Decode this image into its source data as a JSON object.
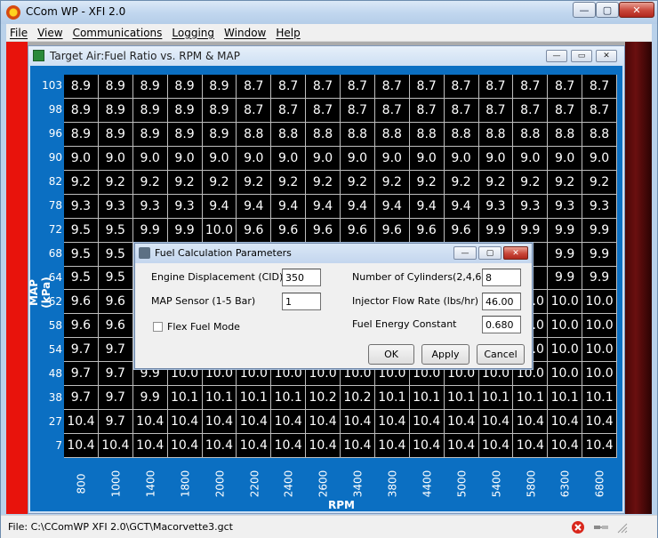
{
  "window": {
    "title": "CCom WP - XFI 2.0",
    "minimize": "—",
    "maximize": "▢",
    "close": "✕"
  },
  "menu": [
    "File",
    "View",
    "Communications",
    "Logging",
    "Window",
    "Help"
  ],
  "child": {
    "title": "Target Air:Fuel Ratio vs. RPM & MAP",
    "minimize": "—",
    "restore": "▭",
    "close": "✕"
  },
  "table": {
    "ylabel": "MAP (kPa)",
    "xlabel": "RPM",
    "rows": [
      "103",
      "98",
      "96",
      "90",
      "82",
      "78",
      "72",
      "68",
      "64",
      "62",
      "58",
      "54",
      "48",
      "38",
      "27",
      "7"
    ],
    "cols": [
      "800",
      "1000",
      "1400",
      "1800",
      "2000",
      "2200",
      "2400",
      "2600",
      "3400",
      "3800",
      "4400",
      "5000",
      "5400",
      "5800",
      "6300",
      "6800"
    ],
    "values": [
      [
        "8.9",
        "8.9",
        "8.9",
        "8.9",
        "8.9",
        "8.7",
        "8.7",
        "8.7",
        "8.7",
        "8.7",
        "8.7",
        "8.7",
        "8.7",
        "8.7",
        "8.7",
        "8.7"
      ],
      [
        "8.9",
        "8.9",
        "8.9",
        "8.9",
        "8.9",
        "8.7",
        "8.7",
        "8.7",
        "8.7",
        "8.7",
        "8.7",
        "8.7",
        "8.7",
        "8.7",
        "8.7",
        "8.7"
      ],
      [
        "8.9",
        "8.9",
        "8.9",
        "8.9",
        "8.9",
        "8.8",
        "8.8",
        "8.8",
        "8.8",
        "8.8",
        "8.8",
        "8.8",
        "8.8",
        "8.8",
        "8.8",
        "8.8"
      ],
      [
        "9.0",
        "9.0",
        "9.0",
        "9.0",
        "9.0",
        "9.0",
        "9.0",
        "9.0",
        "9.0",
        "9.0",
        "9.0",
        "9.0",
        "9.0",
        "9.0",
        "9.0",
        "9.0"
      ],
      [
        "9.2",
        "9.2",
        "9.2",
        "9.2",
        "9.2",
        "9.2",
        "9.2",
        "9.2",
        "9.2",
        "9.2",
        "9.2",
        "9.2",
        "9.2",
        "9.2",
        "9.2",
        "9.2"
      ],
      [
        "9.3",
        "9.3",
        "9.3",
        "9.3",
        "9.4",
        "9.4",
        "9.4",
        "9.4",
        "9.4",
        "9.4",
        "9.4",
        "9.4",
        "9.3",
        "9.3",
        "9.3",
        "9.3"
      ],
      [
        "9.5",
        "9.5",
        "9.9",
        "9.9",
        "10.0",
        "9.6",
        "9.6",
        "9.6",
        "9.6",
        "9.6",
        "9.6",
        "9.6",
        "9.9",
        "9.9",
        "9.9",
        "9.9"
      ],
      [
        "9.5",
        "9.5",
        "",
        "",
        "",
        "",
        "",
        "",
        "",
        "",
        "",
        "",
        "",
        "",
        "9.9",
        "9.9"
      ],
      [
        "9.5",
        "9.5",
        "",
        "",
        "",
        "",
        "",
        "",
        "",
        "",
        "",
        "",
        "",
        "",
        "9.9",
        "9.9"
      ],
      [
        "9.6",
        "9.6",
        "",
        "",
        "",
        "",
        "",
        "",
        "",
        "",
        "",
        "",
        "",
        "10.0",
        "10.0",
        "10.0"
      ],
      [
        "9.6",
        "9.6",
        "",
        "",
        "",
        "",
        "",
        "",
        "",
        "",
        "",
        "",
        "",
        "10.0",
        "10.0",
        "10.0"
      ],
      [
        "9.7",
        "9.7",
        "",
        "",
        "",
        "",
        "",
        "",
        "",
        "",
        "",
        "",
        "",
        "10.0",
        "10.0",
        "10.0"
      ],
      [
        "9.7",
        "9.7",
        "9.9",
        "10.0",
        "10.0",
        "10.0",
        "10.0",
        "10.0",
        "10.0",
        "10.0",
        "10.0",
        "10.0",
        "10.0",
        "10.0",
        "10.0",
        "10.0"
      ],
      [
        "9.7",
        "9.7",
        "9.9",
        "10.1",
        "10.1",
        "10.1",
        "10.1",
        "10.2",
        "10.2",
        "10.1",
        "10.1",
        "10.1",
        "10.1",
        "10.1",
        "10.1",
        "10.1"
      ],
      [
        "10.4",
        "9.7",
        "10.4",
        "10.4",
        "10.4",
        "10.4",
        "10.4",
        "10.4",
        "10.4",
        "10.4",
        "10.4",
        "10.4",
        "10.4",
        "10.4",
        "10.4",
        "10.4"
      ],
      [
        "10.4",
        "10.4",
        "10.4",
        "10.4",
        "10.4",
        "10.4",
        "10.4",
        "10.4",
        "10.4",
        "10.4",
        "10.4",
        "10.4",
        "10.4",
        "10.4",
        "10.4",
        "10.4"
      ]
    ]
  },
  "dialog": {
    "title": "Fuel Calculation Parameters",
    "engine_displacement_label": "Engine Displacement (CID)",
    "engine_displacement_value": "350",
    "map_sensor_label": "MAP Sensor (1-5 Bar)",
    "map_sensor_value": "1",
    "flex_fuel_label": "Flex Fuel Mode",
    "cylinders_label": "Number of Cylinders(2,4,6,8)",
    "cylinders_value": "8",
    "injector_label": "Injector Flow Rate (lbs/hr)",
    "injector_value": "46.00",
    "fuel_energy_label": "Fuel Energy Constant",
    "fuel_energy_value": "0.680",
    "ok": "OK",
    "apply": "Apply",
    "cancel": "Cancel"
  },
  "status": {
    "file": "File: C:\\CComWP XFI 2.0\\GCT\\Macorvette3.gct"
  }
}
